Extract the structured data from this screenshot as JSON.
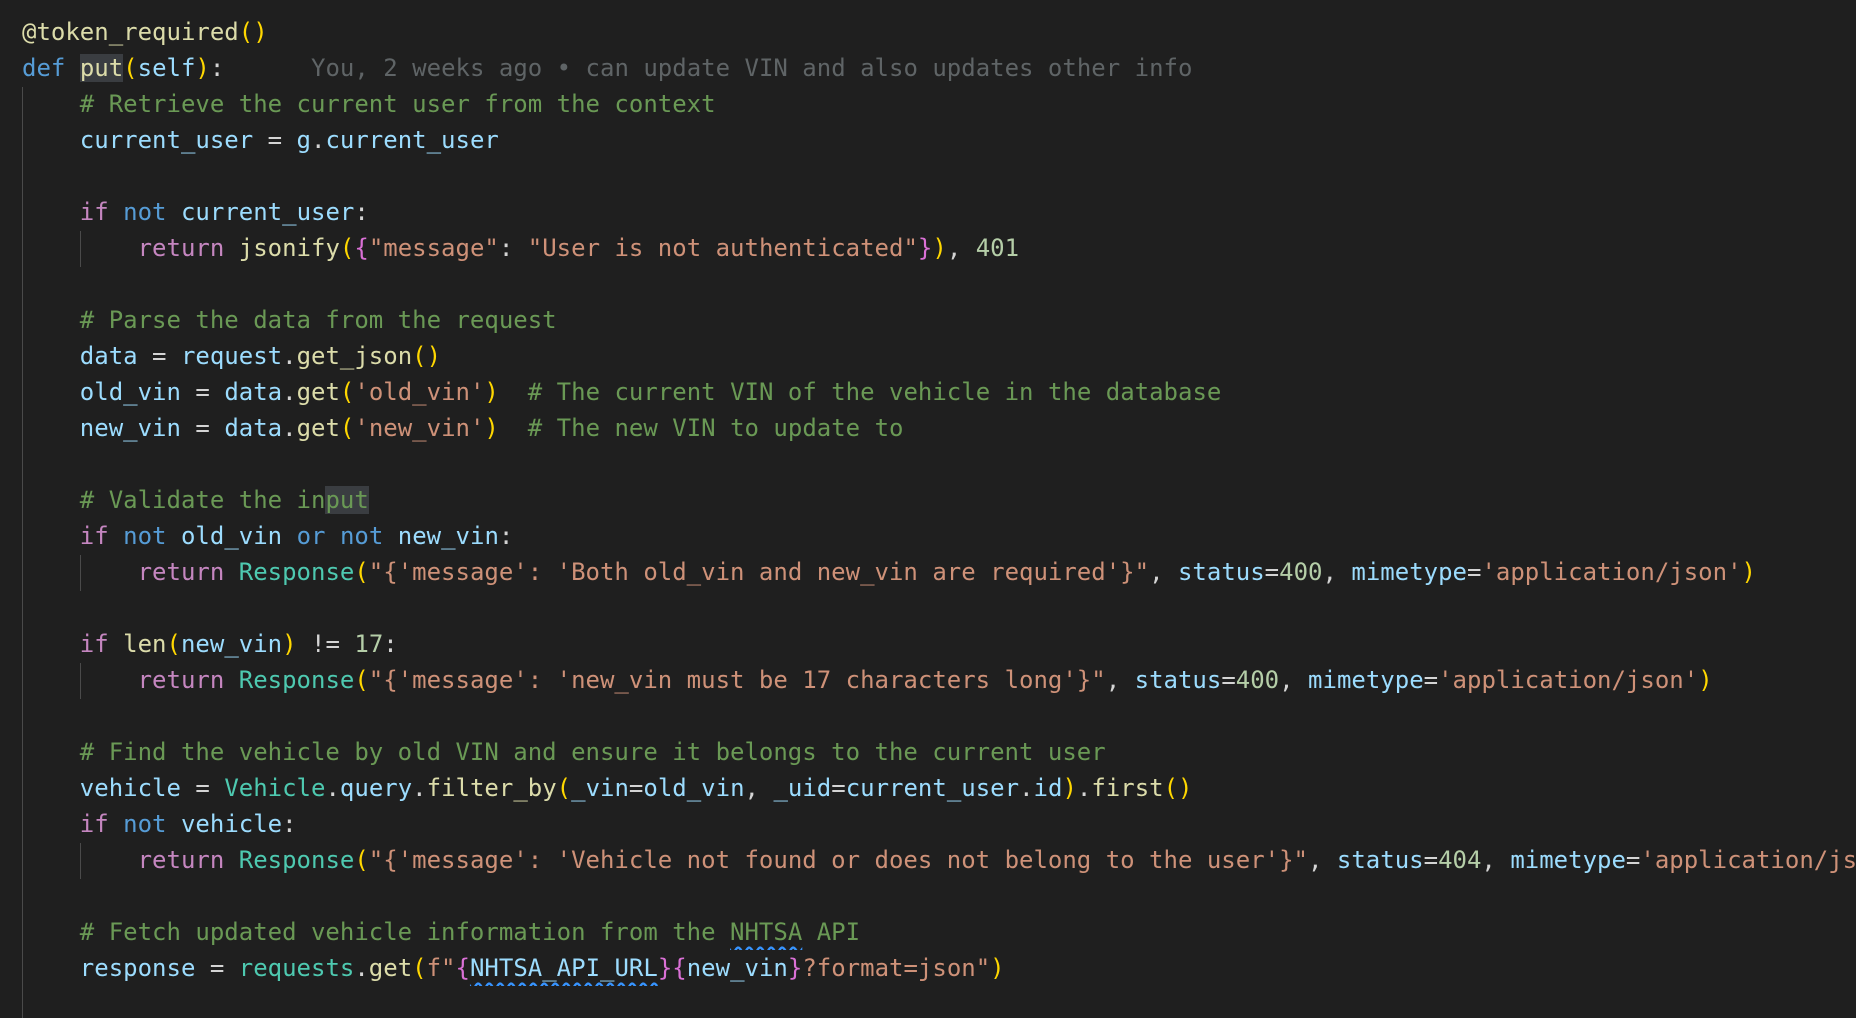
{
  "editor": {
    "lines": [
      {
        "indent": 0,
        "tokens": [
          {
            "t": "@token_required",
            "c": "deco"
          },
          {
            "t": "()",
            "c": "b1"
          }
        ]
      },
      {
        "indent": 0,
        "tokens": [
          {
            "t": "def",
            "c": "kw"
          },
          {
            "t": " ",
            "c": "pl"
          },
          {
            "t": "put",
            "c": "fn",
            "hl": true
          },
          {
            "t": "(",
            "c": "b1"
          },
          {
            "t": "self",
            "c": "self"
          },
          {
            "t": ")",
            "c": "b1"
          },
          {
            "t": ":",
            "c": "pl"
          }
        ],
        "blame": "You, 2 weeks ago • can update VIN and also updates other info"
      },
      {
        "indent": 1,
        "tokens": [
          {
            "t": "# Retrieve the current user from the context",
            "c": "cm"
          }
        ]
      },
      {
        "indent": 1,
        "tokens": [
          {
            "t": "current_user",
            "c": "var"
          },
          {
            "t": " = ",
            "c": "pl"
          },
          {
            "t": "g",
            "c": "var"
          },
          {
            "t": ".",
            "c": "pl"
          },
          {
            "t": "current_user",
            "c": "var"
          }
        ]
      },
      {
        "indent": 0,
        "tokens": []
      },
      {
        "indent": 1,
        "tokens": [
          {
            "t": "if",
            "c": "ctl"
          },
          {
            "t": " ",
            "c": "pl"
          },
          {
            "t": "not",
            "c": "kw"
          },
          {
            "t": " ",
            "c": "pl"
          },
          {
            "t": "current_user",
            "c": "var"
          },
          {
            "t": ":",
            "c": "pl"
          }
        ]
      },
      {
        "indent": 2,
        "tokens": [
          {
            "t": "return",
            "c": "ctl"
          },
          {
            "t": " ",
            "c": "pl"
          },
          {
            "t": "jsonify",
            "c": "fn"
          },
          {
            "t": "(",
            "c": "b1"
          },
          {
            "t": "{",
            "c": "b2"
          },
          {
            "t": "\"message\"",
            "c": "str"
          },
          {
            "t": ": ",
            "c": "pl"
          },
          {
            "t": "\"User is not authenticated\"",
            "c": "str"
          },
          {
            "t": "}",
            "c": "b2"
          },
          {
            "t": ")",
            "c": "b1"
          },
          {
            "t": ", ",
            "c": "pl"
          },
          {
            "t": "401",
            "c": "num"
          }
        ]
      },
      {
        "indent": 0,
        "tokens": []
      },
      {
        "indent": 1,
        "tokens": [
          {
            "t": "# Parse the data from the request",
            "c": "cm"
          }
        ]
      },
      {
        "indent": 1,
        "tokens": [
          {
            "t": "data",
            "c": "var"
          },
          {
            "t": " = ",
            "c": "pl"
          },
          {
            "t": "request",
            "c": "var"
          },
          {
            "t": ".",
            "c": "pl"
          },
          {
            "t": "get_json",
            "c": "fn"
          },
          {
            "t": "()",
            "c": "b1"
          }
        ]
      },
      {
        "indent": 1,
        "tokens": [
          {
            "t": "old_vin",
            "c": "var"
          },
          {
            "t": " = ",
            "c": "pl"
          },
          {
            "t": "data",
            "c": "var"
          },
          {
            "t": ".",
            "c": "pl"
          },
          {
            "t": "get",
            "c": "fn"
          },
          {
            "t": "(",
            "c": "b1"
          },
          {
            "t": "'old_vin'",
            "c": "str"
          },
          {
            "t": ")",
            "c": "b1"
          },
          {
            "t": "  ",
            "c": "pl"
          },
          {
            "t": "# The current VIN of the vehicle in the database",
            "c": "cm"
          }
        ]
      },
      {
        "indent": 1,
        "tokens": [
          {
            "t": "new_vin",
            "c": "var"
          },
          {
            "t": " = ",
            "c": "pl"
          },
          {
            "t": "data",
            "c": "var"
          },
          {
            "t": ".",
            "c": "pl"
          },
          {
            "t": "get",
            "c": "fn"
          },
          {
            "t": "(",
            "c": "b1"
          },
          {
            "t": "'new_vin'",
            "c": "str"
          },
          {
            "t": ")",
            "c": "b1"
          },
          {
            "t": "  ",
            "c": "pl"
          },
          {
            "t": "# The new VIN to update to",
            "c": "cm"
          }
        ]
      },
      {
        "indent": 0,
        "tokens": []
      },
      {
        "indent": 1,
        "tokens": [
          {
            "t": "# Validate the in",
            "c": "cm"
          },
          {
            "t": "put",
            "c": "cm",
            "hl": true
          }
        ]
      },
      {
        "indent": 1,
        "tokens": [
          {
            "t": "if",
            "c": "ctl"
          },
          {
            "t": " ",
            "c": "pl"
          },
          {
            "t": "not",
            "c": "kw"
          },
          {
            "t": " ",
            "c": "pl"
          },
          {
            "t": "old_vin",
            "c": "var"
          },
          {
            "t": " ",
            "c": "pl"
          },
          {
            "t": "or",
            "c": "kw"
          },
          {
            "t": " ",
            "c": "pl"
          },
          {
            "t": "not",
            "c": "kw"
          },
          {
            "t": " ",
            "c": "pl"
          },
          {
            "t": "new_vin",
            "c": "var"
          },
          {
            "t": ":",
            "c": "pl"
          }
        ]
      },
      {
        "indent": 2,
        "tokens": [
          {
            "t": "return",
            "c": "ctl"
          },
          {
            "t": " ",
            "c": "pl"
          },
          {
            "t": "Response",
            "c": "cls"
          },
          {
            "t": "(",
            "c": "b1"
          },
          {
            "t": "\"{'message': 'Both old_vin and new_vin are required'}\"",
            "c": "str"
          },
          {
            "t": ", ",
            "c": "pl"
          },
          {
            "t": "status",
            "c": "var"
          },
          {
            "t": "=",
            "c": "pl"
          },
          {
            "t": "400",
            "c": "num"
          },
          {
            "t": ", ",
            "c": "pl"
          },
          {
            "t": "mimetype",
            "c": "var"
          },
          {
            "t": "=",
            "c": "pl"
          },
          {
            "t": "'application/json'",
            "c": "str"
          },
          {
            "t": ")",
            "c": "b1"
          }
        ]
      },
      {
        "indent": 0,
        "tokens": []
      },
      {
        "indent": 1,
        "tokens": [
          {
            "t": "if",
            "c": "ctl"
          },
          {
            "t": " ",
            "c": "pl"
          },
          {
            "t": "len",
            "c": "fn"
          },
          {
            "t": "(",
            "c": "b1"
          },
          {
            "t": "new_vin",
            "c": "var"
          },
          {
            "t": ")",
            "c": "b1"
          },
          {
            "t": " != ",
            "c": "pl"
          },
          {
            "t": "17",
            "c": "num"
          },
          {
            "t": ":",
            "c": "pl"
          }
        ]
      },
      {
        "indent": 2,
        "tokens": [
          {
            "t": "return",
            "c": "ctl"
          },
          {
            "t": " ",
            "c": "pl"
          },
          {
            "t": "Response",
            "c": "cls"
          },
          {
            "t": "(",
            "c": "b1"
          },
          {
            "t": "\"{'message': 'new_vin must be 17 characters long'}\"",
            "c": "str"
          },
          {
            "t": ", ",
            "c": "pl"
          },
          {
            "t": "status",
            "c": "var"
          },
          {
            "t": "=",
            "c": "pl"
          },
          {
            "t": "400",
            "c": "num"
          },
          {
            "t": ", ",
            "c": "pl"
          },
          {
            "t": "mimetype",
            "c": "var"
          },
          {
            "t": "=",
            "c": "pl"
          },
          {
            "t": "'application/json'",
            "c": "str"
          },
          {
            "t": ")",
            "c": "b1"
          }
        ]
      },
      {
        "indent": 0,
        "tokens": []
      },
      {
        "indent": 1,
        "tokens": [
          {
            "t": "# Find the vehicle by old VIN and ensure it belongs to the current user",
            "c": "cm"
          }
        ]
      },
      {
        "indent": 1,
        "tokens": [
          {
            "t": "vehicle",
            "c": "var"
          },
          {
            "t": " = ",
            "c": "pl"
          },
          {
            "t": "Vehicle",
            "c": "cls"
          },
          {
            "t": ".",
            "c": "pl"
          },
          {
            "t": "query",
            "c": "var"
          },
          {
            "t": ".",
            "c": "pl"
          },
          {
            "t": "filter_by",
            "c": "fn"
          },
          {
            "t": "(",
            "c": "b1"
          },
          {
            "t": "_vin",
            "c": "var"
          },
          {
            "t": "=",
            "c": "pl"
          },
          {
            "t": "old_vin",
            "c": "var"
          },
          {
            "t": ", ",
            "c": "pl"
          },
          {
            "t": "_uid",
            "c": "var"
          },
          {
            "t": "=",
            "c": "pl"
          },
          {
            "t": "current_user",
            "c": "var"
          },
          {
            "t": ".",
            "c": "pl"
          },
          {
            "t": "id",
            "c": "var"
          },
          {
            "t": ")",
            "c": "b1"
          },
          {
            "t": ".",
            "c": "pl"
          },
          {
            "t": "first",
            "c": "fn"
          },
          {
            "t": "()",
            "c": "b1"
          }
        ]
      },
      {
        "indent": 1,
        "tokens": [
          {
            "t": "if",
            "c": "ctl"
          },
          {
            "t": " ",
            "c": "pl"
          },
          {
            "t": "not",
            "c": "kw"
          },
          {
            "t": " ",
            "c": "pl"
          },
          {
            "t": "vehicle",
            "c": "var"
          },
          {
            "t": ":",
            "c": "pl"
          }
        ]
      },
      {
        "indent": 2,
        "tokens": [
          {
            "t": "return",
            "c": "ctl"
          },
          {
            "t": " ",
            "c": "pl"
          },
          {
            "t": "Response",
            "c": "cls"
          },
          {
            "t": "(",
            "c": "b1"
          },
          {
            "t": "\"{'message': 'Vehicle not found or does not belong to the user'}\"",
            "c": "str"
          },
          {
            "t": ", ",
            "c": "pl"
          },
          {
            "t": "status",
            "c": "var"
          },
          {
            "t": "=",
            "c": "pl"
          },
          {
            "t": "404",
            "c": "num"
          },
          {
            "t": ", ",
            "c": "pl"
          },
          {
            "t": "mimetype",
            "c": "var"
          },
          {
            "t": "=",
            "c": "pl"
          },
          {
            "t": "'application/json'",
            "c": "str"
          },
          {
            "t": ")",
            "c": "b1"
          }
        ]
      },
      {
        "indent": 0,
        "tokens": []
      },
      {
        "indent": 1,
        "tokens": [
          {
            "t": "# Fetch updated vehicle information from the ",
            "c": "cm"
          },
          {
            "t": "NHTSA",
            "c": "cm",
            "sq": true
          },
          {
            "t": " API",
            "c": "cm"
          }
        ]
      },
      {
        "indent": 1,
        "tokens": [
          {
            "t": "response",
            "c": "var"
          },
          {
            "t": " = ",
            "c": "pl"
          },
          {
            "t": "requests",
            "c": "cls"
          },
          {
            "t": ".",
            "c": "pl"
          },
          {
            "t": "get",
            "c": "fn"
          },
          {
            "t": "(",
            "c": "b1"
          },
          {
            "t": "f\"",
            "c": "str"
          },
          {
            "t": "{",
            "c": "b2"
          },
          {
            "t": "NHTSA_API_URL",
            "c": "var",
            "sq": true
          },
          {
            "t": "}",
            "c": "b2"
          },
          {
            "t": "{",
            "c": "b2"
          },
          {
            "t": "new_vin",
            "c": "var"
          },
          {
            "t": "}",
            "c": "b2"
          },
          {
            "t": "?format=json\"",
            "c": "str"
          },
          {
            "t": ")",
            "c": "b1"
          }
        ]
      }
    ]
  }
}
